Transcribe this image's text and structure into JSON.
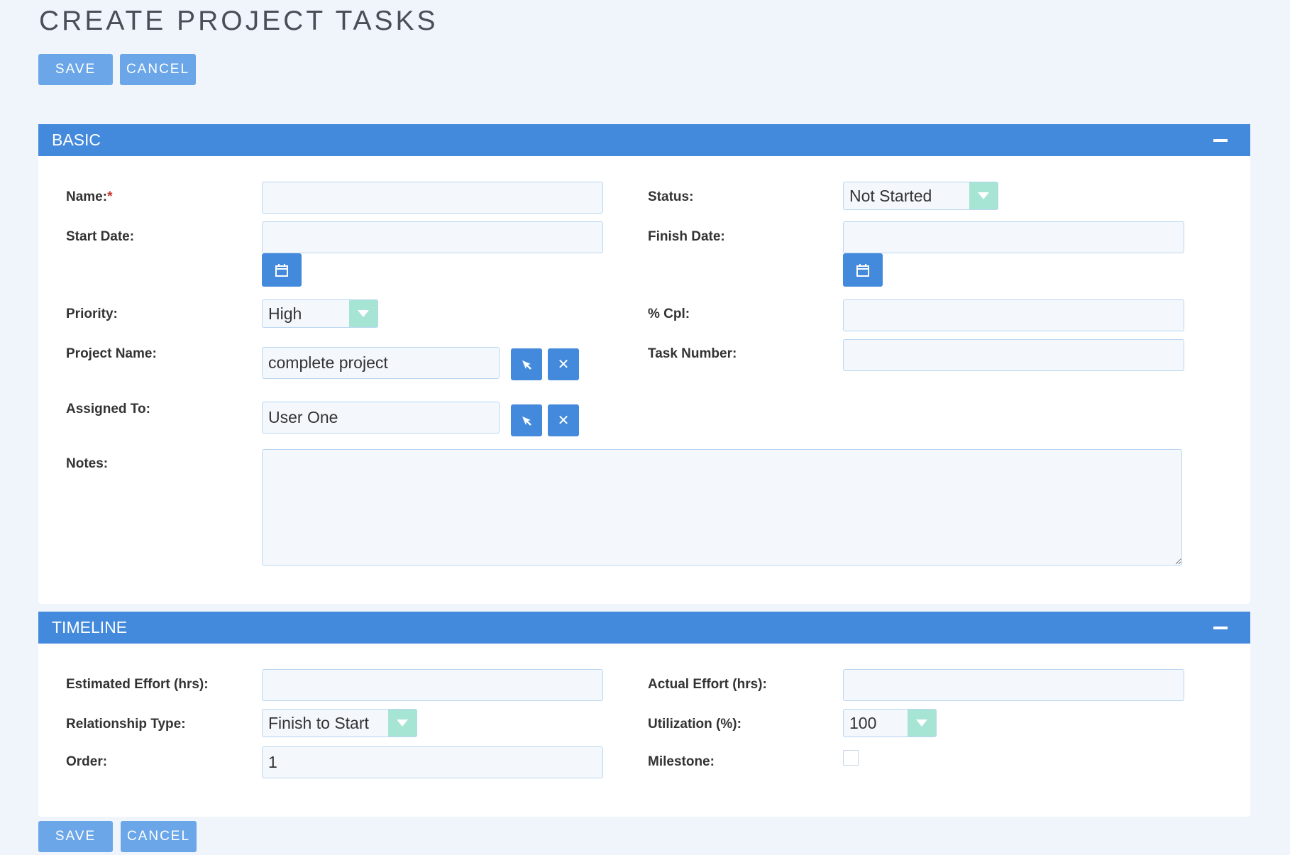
{
  "page": {
    "title": "CREATE PROJECT TASKS"
  },
  "actions": {
    "save_label": "SAVE",
    "cancel_label": "CANCEL"
  },
  "basic": {
    "title": "BASIC",
    "name_label": "Name:",
    "required_mark": "*",
    "name_value": "",
    "status_label": "Status:",
    "status_value": "Not Started",
    "start_date_label": "Start Date:",
    "start_date_value": "",
    "finish_date_label": "Finish Date:",
    "finish_date_value": "",
    "priority_label": "Priority:",
    "priority_value": "High",
    "pct_complete_label": "% Cpl:",
    "pct_complete_value": "",
    "project_name_label": "Project Name:",
    "project_name_value": "complete project",
    "task_number_label": "Task Number:",
    "task_number_value": "",
    "assigned_to_label": "Assigned To:",
    "assigned_to_value": "User One",
    "notes_label": "Notes:",
    "notes_value": ""
  },
  "timeline": {
    "title": "TIMELINE",
    "estimated_effort_label": "Estimated Effort (hrs):",
    "estimated_effort_value": "",
    "actual_effort_label": "Actual Effort (hrs):",
    "actual_effort_value": "",
    "relationship_type_label": "Relationship Type:",
    "relationship_type_value": "Finish to Start",
    "utilization_label": "Utilization (%):",
    "utilization_value": "100",
    "order_label": "Order:",
    "order_value": "1",
    "milestone_label": "Milestone:",
    "milestone_checked": false
  },
  "colors": {
    "accent": "#4389dc",
    "button": "#6aa6e8",
    "select_arrow": "#a6e4d3",
    "required": "#c0392b"
  },
  "icons": [
    "calendar-icon",
    "select-arrow-icon",
    "clear-icon",
    "collapse-icon"
  ]
}
